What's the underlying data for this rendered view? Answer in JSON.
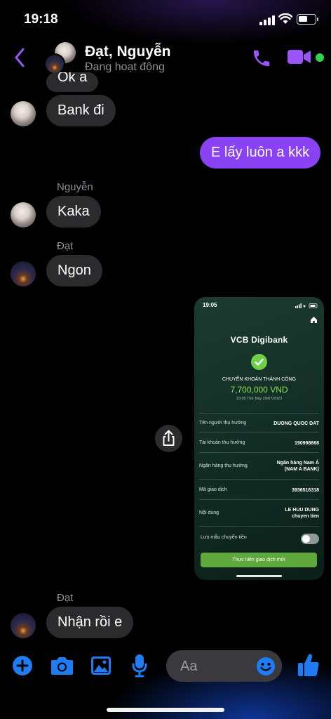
{
  "status": {
    "time": "19:18"
  },
  "header": {
    "name": "Đạt, Nguyễn",
    "status": "Đang hoạt động"
  },
  "messages": {
    "ok_partial": "Ok a",
    "bank": "Bank đi",
    "outgoing": "E lấy luôn a kkk",
    "sender_nguyen": "Nguyễn",
    "kaka": "Kaka",
    "sender_dat": "Đạt",
    "ngon": "Ngon",
    "sender_dat_2": "Đạt",
    "nhan_roi": "Nhận rồi e"
  },
  "receipt": {
    "time": "19:05",
    "brand": "VCB Digibank",
    "title": "CHUYỂN KHOẢN THÀNH CÔNG",
    "amount": "7,700,000 VND",
    "date": "19:05 Thứ Bảy 29/07/2023",
    "rows": [
      {
        "label": "Tên người thụ hưởng",
        "value": "DUONG QUOC DAT"
      },
      {
        "label": "Tài khoản thụ hưởng",
        "value": "190998668"
      },
      {
        "label": "Ngân hàng thụ hưởng",
        "value": "Ngân hàng  Nam Á (NAM A BANK)"
      },
      {
        "label": "Mã giao dịch",
        "value": "3936516318"
      },
      {
        "label": "Nội dung",
        "value": "LE HUU DUNG chuyen tien"
      },
      {
        "label": "Lưu mẫu chuyển tiền",
        "toggle_on": false
      }
    ],
    "button": "Thực hiện giao dịch mới"
  },
  "composer": {
    "placeholder": "Aa"
  },
  "colors": {
    "accent": "#8a42f5",
    "incoming_bubble": "#2b2b2d",
    "online": "#31d24b",
    "composer_icons": "#1f7cf2"
  }
}
